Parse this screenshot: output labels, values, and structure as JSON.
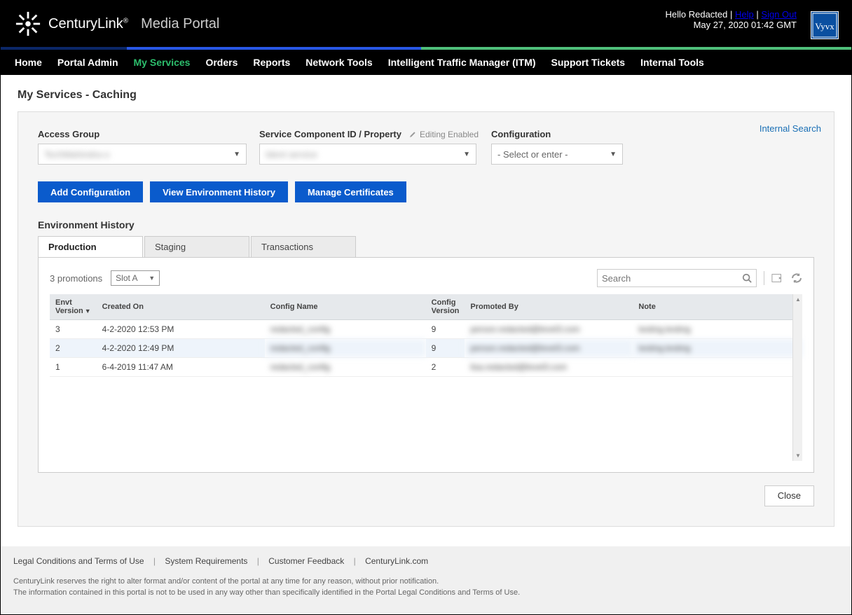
{
  "header": {
    "brand": "CenturyLink",
    "portal": "Media Portal",
    "greeting": "Hello",
    "username": "Redacted",
    "help": "Help",
    "signout": "Sign Out",
    "timestamp": "May 27, 2020 01:42 GMT",
    "vyvx": "Vyvx"
  },
  "nav": {
    "home": "Home",
    "portal_admin": "Portal Admin",
    "my_services": "My Services",
    "orders": "Orders",
    "reports": "Reports",
    "network_tools": "Network Tools",
    "itm": "Intelligent Traffic Manager (ITM)",
    "support_tickets": "Support Tickets",
    "internal_tools": "Internal Tools"
  },
  "page": {
    "title": "My Services - Caching",
    "internal_search": "Internal Search",
    "labels": {
      "access_group": "Access Group",
      "scid": "Service Component ID / Property",
      "editing_enabled": "Editing Enabled",
      "configuration": "Configuration"
    },
    "selects": {
      "access_group_val": "TechMahindra-o",
      "scid_val": "Ident service",
      "config_placeholder": "- Select or enter -"
    },
    "buttons": {
      "add_config": "Add Configuration",
      "view_history": "View Environment History",
      "manage_certs": "Manage Certificates",
      "close": "Close"
    },
    "section_title": "Environment History",
    "tabs": {
      "production": "Production",
      "staging": "Staging",
      "transactions": "Transactions"
    },
    "table": {
      "promotions_text": "3 promotions",
      "slot_value": "Slot A",
      "search_placeholder": "Search",
      "headers": {
        "envt_version": "Envt Version",
        "created_on": "Created On",
        "config_name": "Config Name",
        "config_version": "Config Version",
        "promoted_by": "Promoted By",
        "note": "Note"
      },
      "rows": [
        {
          "envt": "3",
          "created": "4-2-2020 12:53 PM",
          "config_name": "redacted_config",
          "config_version": "9",
          "promoted_by": "person.redacted@level3.com",
          "note": "testing.testing"
        },
        {
          "envt": "2",
          "created": "4-2-2020 12:49 PM",
          "config_name": "redacted_config",
          "config_version": "9",
          "promoted_by": "person.redacted@level3.com",
          "note": "testing.testing"
        },
        {
          "envt": "1",
          "created": "6-4-2019 11:47 AM",
          "config_name": "redacted_config",
          "config_version": "2",
          "promoted_by": "lisa.redacted@level3.com",
          "note": ""
        }
      ]
    }
  },
  "footer": {
    "links": {
      "legal": "Legal Conditions and Terms of Use",
      "sysreq": "System Requirements",
      "feedback": "Customer Feedback",
      "cl": "CenturyLink.com"
    },
    "disclaimer1": "CenturyLink reserves the right to alter format and/or content of the portal at any time for any reason, without prior notification.",
    "disclaimer2": "The information contained in this portal is not to be used in any way other than specifically identified in the Portal Legal Conditions and Terms of Use."
  }
}
